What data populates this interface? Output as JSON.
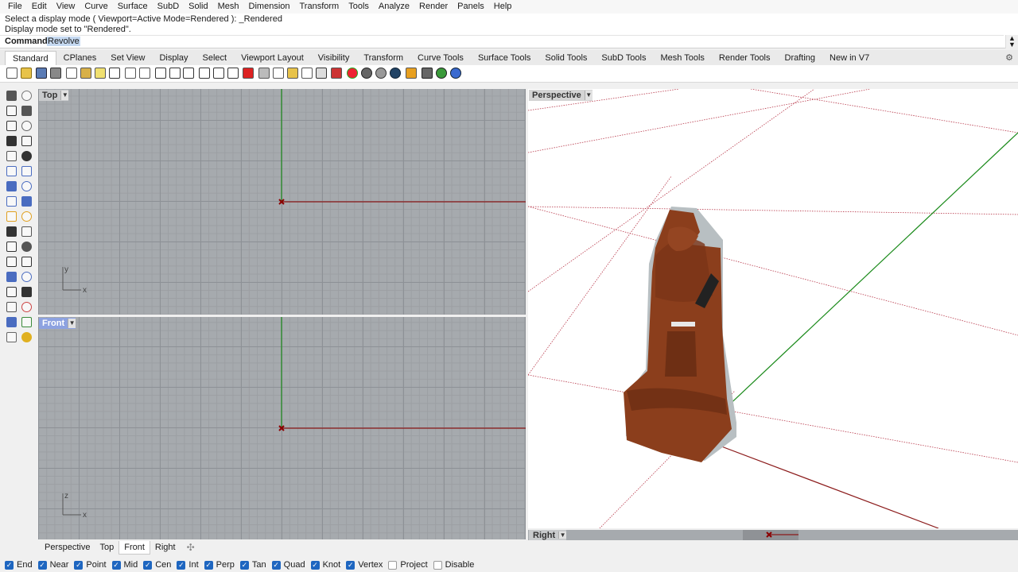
{
  "menu": [
    "File",
    "Edit",
    "View",
    "Curve",
    "Surface",
    "SubD",
    "Solid",
    "Mesh",
    "Dimension",
    "Transform",
    "Tools",
    "Analyze",
    "Render",
    "Panels",
    "Help"
  ],
  "command": {
    "history": [
      "Select a display mode ( Viewport=Active  Mode=Rendered ): _Rendered",
      "Display mode set to \"Rendered\"."
    ],
    "prompt_label": "Command:",
    "prompt_value": "Revolve"
  },
  "toolbar_tabs": [
    "Standard",
    "CPlanes",
    "Set View",
    "Display",
    "Select",
    "Viewport Layout",
    "Visibility",
    "Transform",
    "Curve Tools",
    "Surface Tools",
    "Solid Tools",
    "SubD Tools",
    "Mesh Tools",
    "Render Tools",
    "Drafting",
    "New in V7"
  ],
  "active_toolbar_tab": "Standard",
  "viewports": {
    "top": {
      "label": "Top",
      "axis_v": "y",
      "axis_h": "x"
    },
    "front": {
      "label": "Front",
      "axis_v": "z",
      "axis_h": "x"
    },
    "perspective": {
      "label": "Perspective"
    },
    "right": {
      "label": "Right"
    }
  },
  "viewport_tabs": [
    "Perspective",
    "Top",
    "Front",
    "Right"
  ],
  "active_viewport_tab": "Front",
  "osnaps": [
    {
      "label": "End",
      "checked": true
    },
    {
      "label": "Near",
      "checked": true
    },
    {
      "label": "Point",
      "checked": true
    },
    {
      "label": "Mid",
      "checked": true
    },
    {
      "label": "Cen",
      "checked": true
    },
    {
      "label": "Int",
      "checked": true
    },
    {
      "label": "Perp",
      "checked": true
    },
    {
      "label": "Tan",
      "checked": true
    },
    {
      "label": "Quad",
      "checked": true
    },
    {
      "label": "Knot",
      "checked": true
    },
    {
      "label": "Vertex",
      "checked": true
    },
    {
      "label": "Project",
      "checked": false
    },
    {
      "label": "Disable",
      "checked": false
    }
  ],
  "colors": {
    "x_axis": "#8b1a1a",
    "y_axis": "#1a8a1a",
    "model": "#8b3e1c",
    "grid_bg": "#a6aaae",
    "active_label": "#8da2e0"
  }
}
